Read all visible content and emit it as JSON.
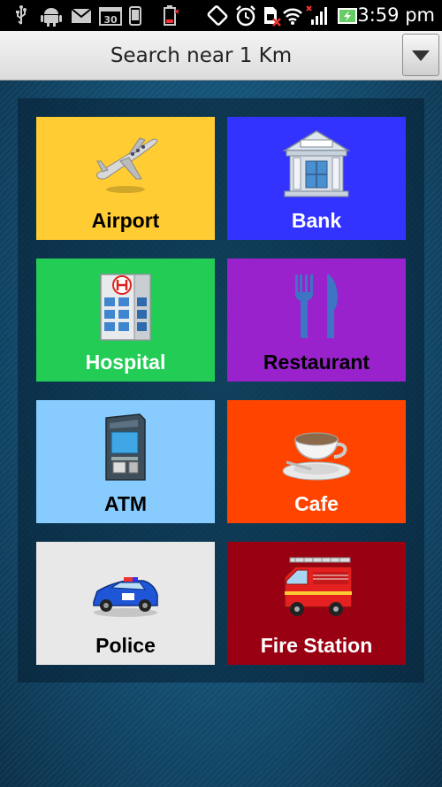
{
  "status_bar": {
    "time": "3:59 pm",
    "icons": [
      "usb-icon",
      "android-debug-icon",
      "gmail-icon",
      "calendar-icon",
      "phone-icon",
      "battery-low-icon",
      "screen-rotate-icon",
      "alarm-icon",
      "sim-error-icon",
      "wifi-icon",
      "signal-icon",
      "battery-charging-icon"
    ],
    "calendar_day": "30"
  },
  "header": {
    "title": "Search near 1 Km",
    "dropdown_icon": "chevron-down-icon"
  },
  "tiles": [
    {
      "label": "Airport",
      "icon": "airplane-icon",
      "bg": "#ffcc33",
      "text_color": "#000000"
    },
    {
      "label": "Bank",
      "icon": "bank-icon",
      "bg": "#3333ff",
      "text_color": "#ffffff"
    },
    {
      "label": "Hospital",
      "icon": "hospital-icon",
      "bg": "#22cc55",
      "text_color": "#ffffff"
    },
    {
      "label": "Restaurant",
      "icon": "fork-knife-icon",
      "bg": "#9922cc",
      "text_color": "#000000"
    },
    {
      "label": "ATM",
      "icon": "atm-icon",
      "bg": "#88ccff",
      "text_color": "#000000"
    },
    {
      "label": "Cafe",
      "icon": "coffee-cup-icon",
      "bg": "#ff4400",
      "text_color": "#ffffff"
    },
    {
      "label": "Police",
      "icon": "police-car-icon",
      "bg": "#e8e8e8",
      "text_color": "#000000"
    },
    {
      "label": "Fire Station",
      "icon": "fire-truck-icon",
      "bg": "#990011",
      "text_color": "#ffffff"
    }
  ]
}
